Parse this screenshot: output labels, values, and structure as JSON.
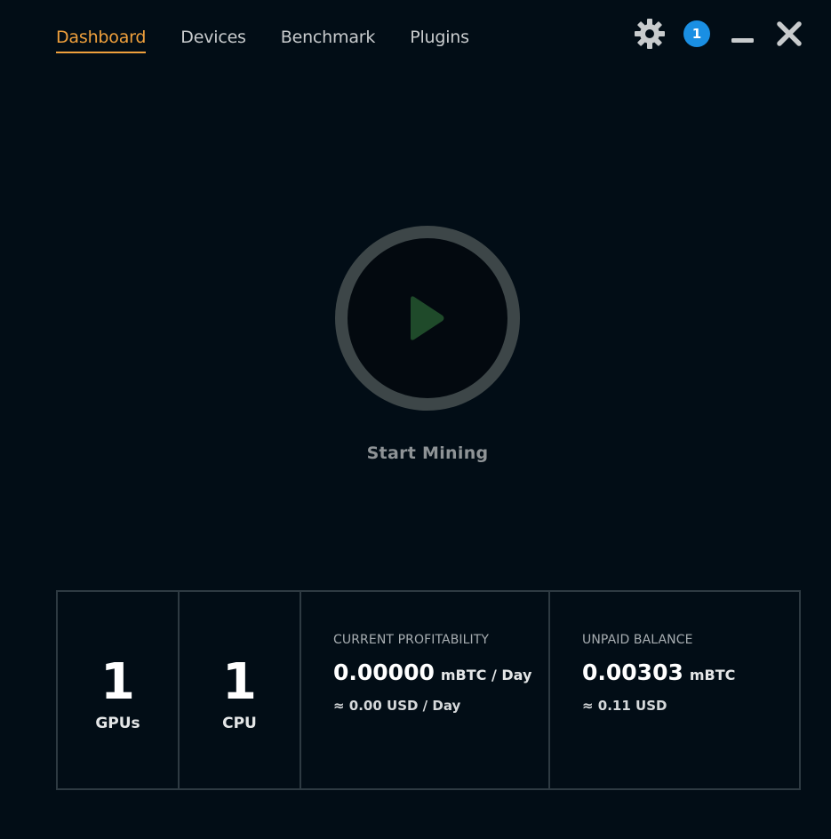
{
  "nav": {
    "tabs": [
      {
        "label": "Dashboard",
        "active": true
      },
      {
        "label": "Devices",
        "active": false
      },
      {
        "label": "Benchmark",
        "active": false
      },
      {
        "label": "Plugins",
        "active": false
      }
    ]
  },
  "controls": {
    "notification_count": "1",
    "icons": [
      "gear-icon",
      "notification-badge",
      "minimize-icon",
      "close-icon"
    ]
  },
  "mining": {
    "button_label": "Start Mining",
    "icon": "play-icon"
  },
  "stats": {
    "gpus": {
      "value": "1",
      "label": "GPUs"
    },
    "cpu": {
      "value": "1",
      "label": "CPU"
    },
    "profitability": {
      "title": "CURRENT PROFITABILITY",
      "value": "0.00000",
      "unit": "mBTC / Day",
      "usd": "≈ 0.00 USD / Day"
    },
    "balance": {
      "title": "UNPAID BALANCE",
      "value": "0.00303",
      "unit": "mBTC",
      "usd": "≈ 0.11 USD"
    }
  },
  "colors": {
    "background": "#020d16",
    "accent": "#f0a03c",
    "badge": "#1a8fe3",
    "play": "#1f4a2a",
    "ring": "#3d4648"
  }
}
